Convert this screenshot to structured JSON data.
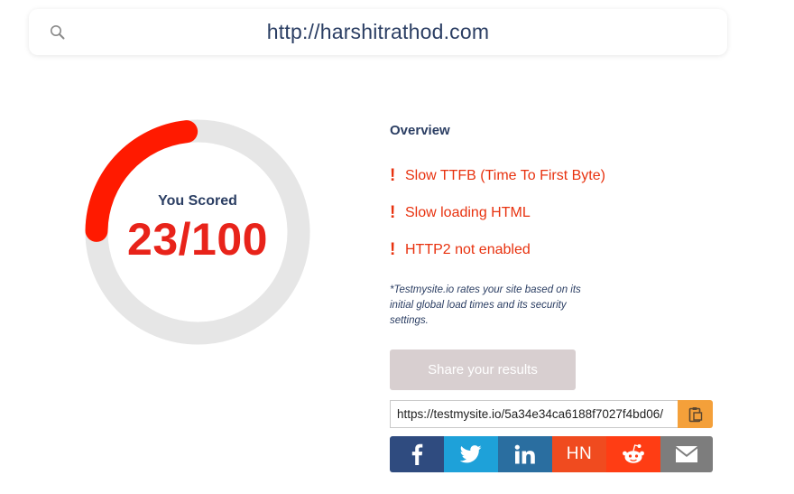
{
  "search": {
    "url": "http://harshitrathod.com",
    "icon": "search-icon"
  },
  "score": {
    "heading": "You Scored",
    "value_text": "23/100",
    "value": 23,
    "max": 100,
    "ring_color": "#ff1a00",
    "track_color": "#e6e6e6"
  },
  "overview": {
    "title": "Overview",
    "issues": [
      {
        "icon": "!",
        "text": "Slow TTFB (Time To First Byte)"
      },
      {
        "icon": "!",
        "text": "Slow loading HTML"
      },
      {
        "icon": "!",
        "text": "HTTP2 not enabled"
      }
    ],
    "note": "*Testmysite.io rates your site based on its initial global load times and its security settings."
  },
  "share": {
    "button_label": "Share your results",
    "link_value": "https://testmysite.io/5a34e34ca6188f7027f4bd06/",
    "copy_icon": "clipboard-icon",
    "copy_color": "#f4a03a",
    "buttons": [
      {
        "name": "facebook",
        "icon": "facebook-icon",
        "color": "#2f4b7f"
      },
      {
        "name": "twitter",
        "icon": "twitter-icon",
        "color": "#1ea1d9"
      },
      {
        "name": "linkedin",
        "icon": "linkedin-icon",
        "color": "#2a6ea0"
      },
      {
        "name": "hacker-news",
        "label": "HN",
        "color": "#f04b1f"
      },
      {
        "name": "reddit",
        "icon": "reddit-icon",
        "color": "#ff3d14"
      },
      {
        "name": "email",
        "icon": "mail-icon",
        "color": "#7d7d7d"
      }
    ]
  }
}
